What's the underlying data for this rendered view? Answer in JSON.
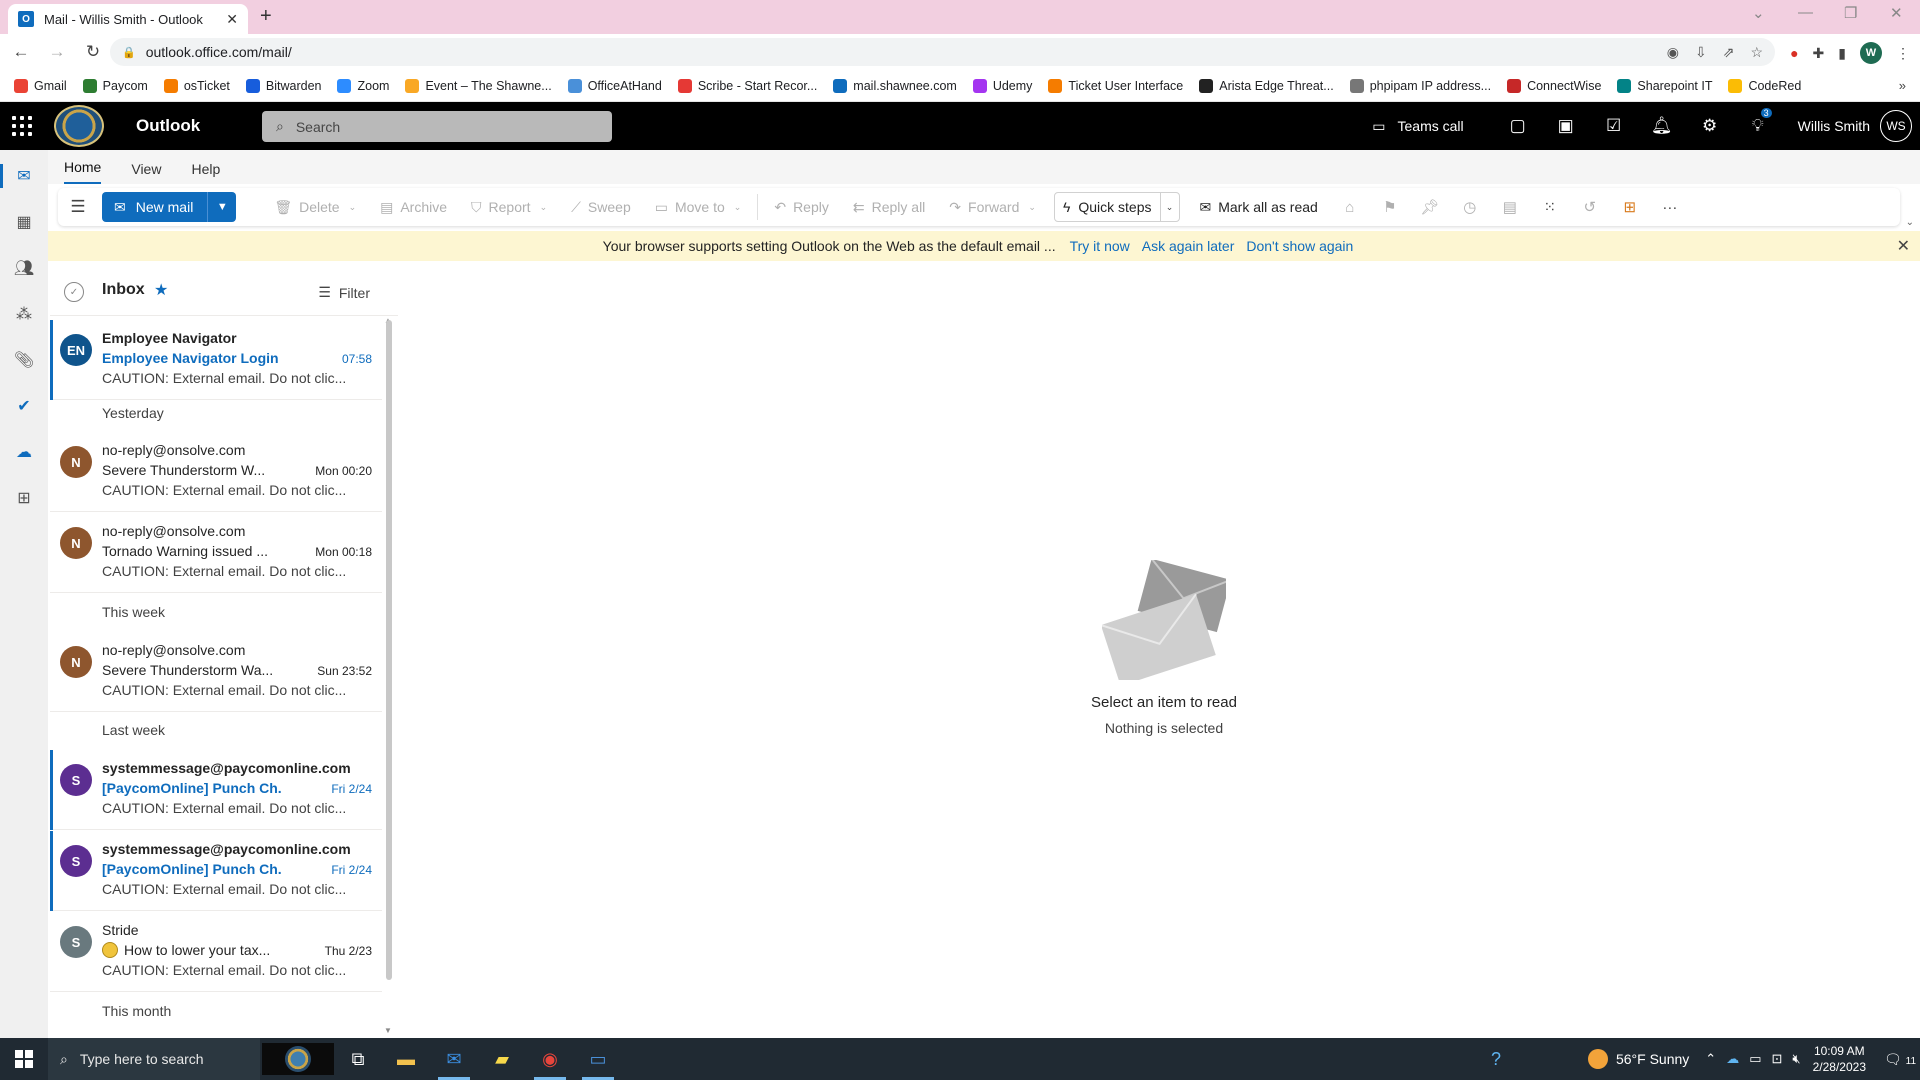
{
  "browser": {
    "tab_title": "Mail - Willis Smith - Outlook",
    "url": "outlook.office.com/mail/",
    "profile_initial": "W",
    "bookmarks": [
      {
        "label": "Gmail",
        "color": "#ea4335"
      },
      {
        "label": "Paycom",
        "color": "#2e7d32"
      },
      {
        "label": "osTicket",
        "color": "#f57c00"
      },
      {
        "label": "Bitwarden",
        "color": "#175ddc"
      },
      {
        "label": "Zoom",
        "color": "#2d8cff"
      },
      {
        "label": "Event – The Shawne...",
        "color": "#f9a825"
      },
      {
        "label": "OfficeAtHand",
        "color": "#4a90d9"
      },
      {
        "label": "Scribe - Start Recor...",
        "color": "#e53935"
      },
      {
        "label": "mail.shawnee.com",
        "color": "#0f6cbd"
      },
      {
        "label": "Udemy",
        "color": "#a435f0"
      },
      {
        "label": "Ticket User Interface",
        "color": "#f57c00"
      },
      {
        "label": "Arista Edge Threat...",
        "color": "#222222"
      },
      {
        "label": "phpipam IP address...",
        "color": "#777777"
      },
      {
        "label": "ConnectWise",
        "color": "#c62828"
      },
      {
        "label": "Sharepoint IT",
        "color": "#038387"
      },
      {
        "label": "CodeRed",
        "color": "#fbbc05"
      }
    ],
    "bookmarks_more": "»"
  },
  "header": {
    "app_title": "Outlook",
    "search_placeholder": "Search",
    "teams_call": "Teams call",
    "tips_badge": "3",
    "user_name": "Willis Smith",
    "user_initials": "WS"
  },
  "ribbon": {
    "tabs": [
      "Home",
      "View",
      "Help"
    ],
    "new_mail": "New mail",
    "delete": "Delete",
    "archive": "Archive",
    "report": "Report",
    "sweep": "Sweep",
    "move_to": "Move to",
    "reply": "Reply",
    "reply_all": "Reply all",
    "forward": "Forward",
    "quick_steps": "Quick steps",
    "mark_all_read": "Mark all as read",
    "more": "···"
  },
  "notice": {
    "text": "Your browser supports setting Outlook on the Web as the default email ...",
    "try_now": "Try it now",
    "ask_later": "Ask again later",
    "dont_show": "Don't show again"
  },
  "list": {
    "folder": "Inbox",
    "filter": "Filter",
    "groups": {
      "yesterday": "Yesterday",
      "this_week": "This week",
      "last_week": "Last week",
      "this_month": "This month"
    },
    "messages": [
      {
        "initials": "EN",
        "color": "#0f548c",
        "sender": "Employee Navigator",
        "subject": "Employee Navigator Login ...",
        "time": "07:58",
        "preview": "CAUTION: External email. Do not clic...",
        "unread": true
      },
      {
        "initials": "N",
        "color": "#8e562e",
        "sender": "no-reply@onsolve.com",
        "subject": "Severe Thunderstorm W...",
        "time": "Mon 00:20",
        "preview": "CAUTION: External email. Do not clic...",
        "unread": false
      },
      {
        "initials": "N",
        "color": "#8e562e",
        "sender": "no-reply@onsolve.com",
        "subject": "Tornado Warning issued ...",
        "time": "Mon 00:18",
        "preview": "CAUTION: External email. Do not clic...",
        "unread": false
      },
      {
        "initials": "N",
        "color": "#8e562e",
        "sender": "no-reply@onsolve.com",
        "subject": "Severe Thunderstorm Wa...",
        "time": "Sun 23:52",
        "preview": "CAUTION: External email. Do not clic...",
        "unread": false
      },
      {
        "initials": "S",
        "color": "#5c2e91",
        "sender": "systemmessage@paycomonline.com",
        "subject": "[PaycomOnline] Punch Ch...",
        "time": "Fri 2/24",
        "preview": "CAUTION: External email. Do not clic...",
        "unread": true
      },
      {
        "initials": "S",
        "color": "#5c2e91",
        "sender": "systemmessage@paycomonline.com",
        "subject": "[PaycomOnline] Punch Ch...",
        "time": "Fri 2/24",
        "preview": "CAUTION: External email. Do not clic...",
        "unread": true
      },
      {
        "initials": "S",
        "color": "#69797e",
        "sender": "Stride",
        "subject": "How to lower your tax...",
        "time": "Thu 2/23",
        "preview": "CAUTION: External email. Do not clic...",
        "unread": false
      }
    ]
  },
  "reading": {
    "title": "Select an item to read",
    "subtitle": "Nothing is selected"
  },
  "taskbar": {
    "search_placeholder": "Type here to search",
    "weather": "56°F  Sunny",
    "time": "10:09 AM",
    "date": "2/28/2023",
    "notif_count": "11"
  },
  "colors": {
    "accent": "#0f6cbd",
    "header_bg": "#000000",
    "notice_bg": "#fdf6d2"
  }
}
